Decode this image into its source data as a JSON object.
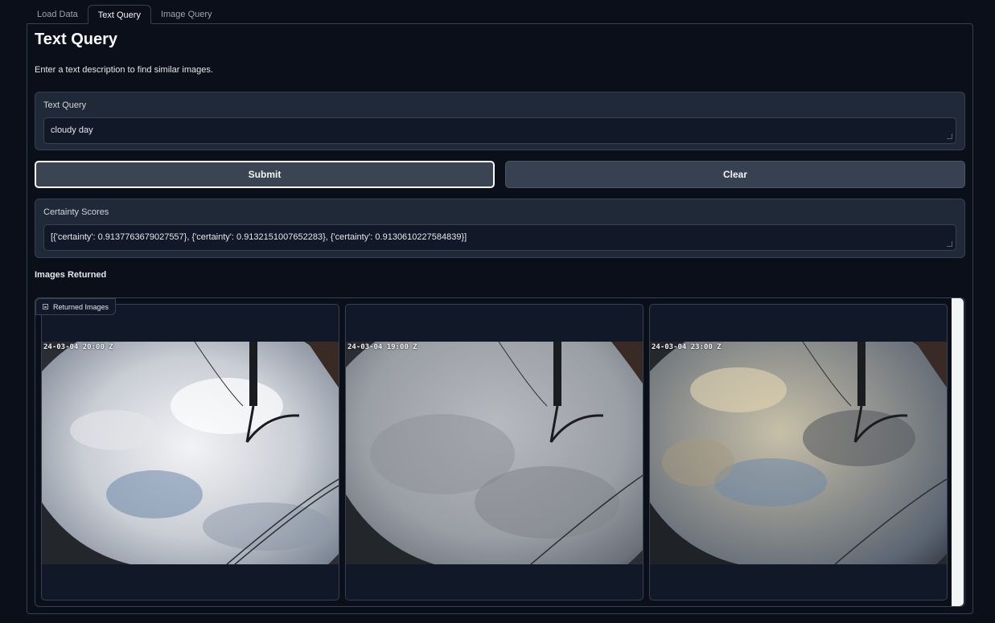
{
  "tabs": [
    {
      "label": "Load Data"
    },
    {
      "label": "Text Query",
      "active": true
    },
    {
      "label": "Image Query"
    }
  ],
  "page": {
    "title": "Text Query",
    "description": "Enter a text description to find similar images."
  },
  "query": {
    "label": "Text Query",
    "value": "cloudy day"
  },
  "buttons": {
    "submit": "Submit",
    "clear": "Clear"
  },
  "scores": {
    "label": "Certainty Scores",
    "value": "[{'certainty': 0.9137763679027557}, {'certainty': 0.9132151007652283}, {'certainty': 0.9130610227584839}]"
  },
  "results": {
    "section_label": "Images Returned",
    "gallery_label": "Returned Images",
    "gallery_icon": "image-icon",
    "images": [
      {
        "timestamp": "24-03-04 20:00 Z"
      },
      {
        "timestamp": "24-03-04 19:00 Z"
      },
      {
        "timestamp": "24-03-04 23:00 Z"
      }
    ]
  }
}
